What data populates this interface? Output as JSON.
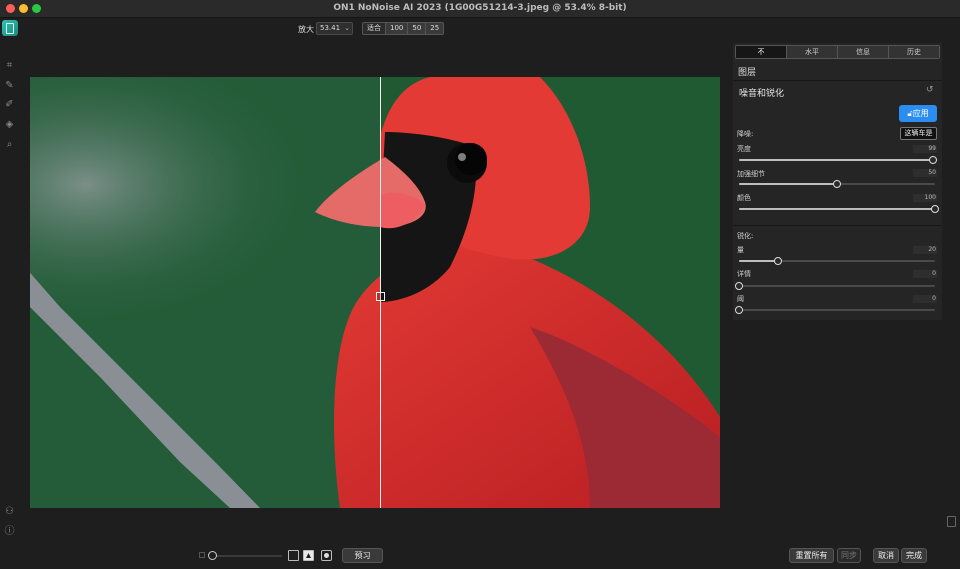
{
  "window": {
    "title": "ON1 NoNoise AI 2023 (1G00G51214-3.jpeg @ 53.4% 8-bit)"
  },
  "toolbar": {
    "zoom_label": "放大",
    "zoom_value": "53.41",
    "zoom_presets": [
      "适合",
      "100",
      "50",
      "25"
    ]
  },
  "left_tools": [
    "crop-icon",
    "brush-icon",
    "mask-brush-icon",
    "eraser-icon",
    "zoom-icon"
  ],
  "panel": {
    "tabs": [
      "不",
      "水平",
      "信息",
      "历史"
    ],
    "active_tab": 0,
    "layers_title": "图层",
    "section_title": "噪音和锐化",
    "apply_label": "应用",
    "tooltip": "这辆车是",
    "noise": {
      "label": "降噪:",
      "sliders": [
        {
          "label": "亮度",
          "value": 99
        },
        {
          "label": "加强细节",
          "value": 50
        },
        {
          "label": "颜色",
          "value": 100
        }
      ]
    },
    "sharpen": {
      "label": "锐化:",
      "sliders": [
        {
          "label": "量",
          "value": 20
        },
        {
          "label": "详情",
          "value": 0
        },
        {
          "label": "阈",
          "value": 0
        }
      ]
    }
  },
  "bottom": {
    "preview_label": "预习",
    "reset_all_label": "重置所有",
    "sync_label": "同步",
    "cancel_label": "取消",
    "done_label": "完成"
  },
  "colors": {
    "accent": "#2b8df0",
    "canvas_bg": "#1d5c34"
  }
}
